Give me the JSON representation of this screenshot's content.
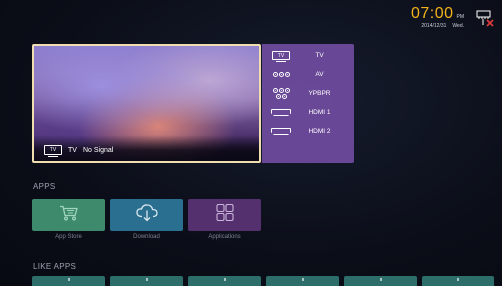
{
  "status": {
    "time": "07:00",
    "ampm": "PM",
    "date": "2014/12/31",
    "weekday": "Wed."
  },
  "preview": {
    "source_badge": "TV",
    "source": "TV",
    "status_text": "No Signal"
  },
  "sources": {
    "items": [
      {
        "label": "TV",
        "icon": "tv-icon",
        "badge": "TV"
      },
      {
        "label": "AV",
        "icon": "av-icon"
      },
      {
        "label": "YPBPR",
        "icon": "ypbpr-icon"
      },
      {
        "label": "HDMI 1",
        "icon": "hdmi-icon"
      },
      {
        "label": "HDMI 2",
        "icon": "hdmi-icon"
      }
    ]
  },
  "apps": {
    "title": "APPS",
    "items": [
      {
        "label": "App Store",
        "icon": "shopping-cart-icon",
        "color": "#3e8a6c"
      },
      {
        "label": "Download",
        "icon": "cloud-download-icon",
        "color": "#2a6f8f"
      },
      {
        "label": "Applications",
        "icon": "grid-icon",
        "color": "#55306e"
      }
    ]
  },
  "like_apps": {
    "title": "LIKE APPS",
    "count_visible": 6
  },
  "colors": {
    "accent_clock": "#f2b21b",
    "source_panel": "#7850aa",
    "preview_border": "#f0ddb0"
  }
}
